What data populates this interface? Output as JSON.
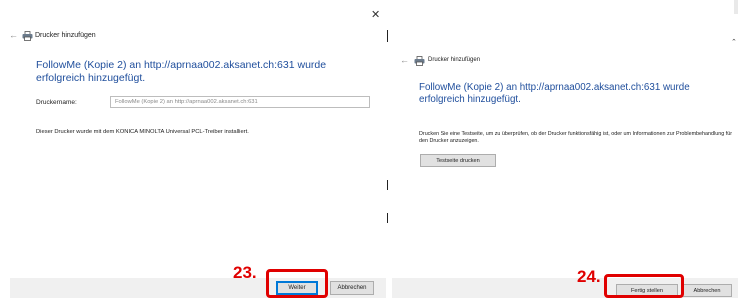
{
  "left_dialog": {
    "title": "Drucker hinzufügen",
    "heading": "FollowMe (Kopie 2) an http://aprnaa002.aksanet.ch:631 wurde erfolgreich hinzugefügt.",
    "printer_name_label": "Druckername:",
    "printer_name_value": "FollowMe (Kopie 2) an http://aprnaa002.aksanet.ch:631",
    "driver_info": "Dieser Drucker wurde mit dem KONICA MINOLTA Universal PCL-Treiber installiert.",
    "next_button": "Weiter",
    "cancel_button": "Abbrechen",
    "step_number": "23."
  },
  "right_dialog": {
    "title": "Drucker hinzufügen",
    "heading": "FollowMe (Kopie 2) an http://aprnaa002.aksanet.ch:631 wurde erfolgreich hinzugefügt.",
    "test_info": "Drucken Sie eine Testseite, um zu überprüfen, ob der Drucker funktionsfähig ist, oder um Informationen zur Problembehandlung für den Drucker anzuzeigen.",
    "test_page_button": "Testseite drucken",
    "finish_button": "Fertig stellen",
    "cancel_button": "Abbrechen",
    "step_number": "24."
  },
  "icons": {
    "back": "back-arrow-icon",
    "printer": "printer-icon",
    "close": "close-icon",
    "collapse": "chevron-up-icon"
  },
  "colors": {
    "heading": "#1f4e9c",
    "highlight": "#e00000",
    "primary_border": "#0078d7"
  }
}
